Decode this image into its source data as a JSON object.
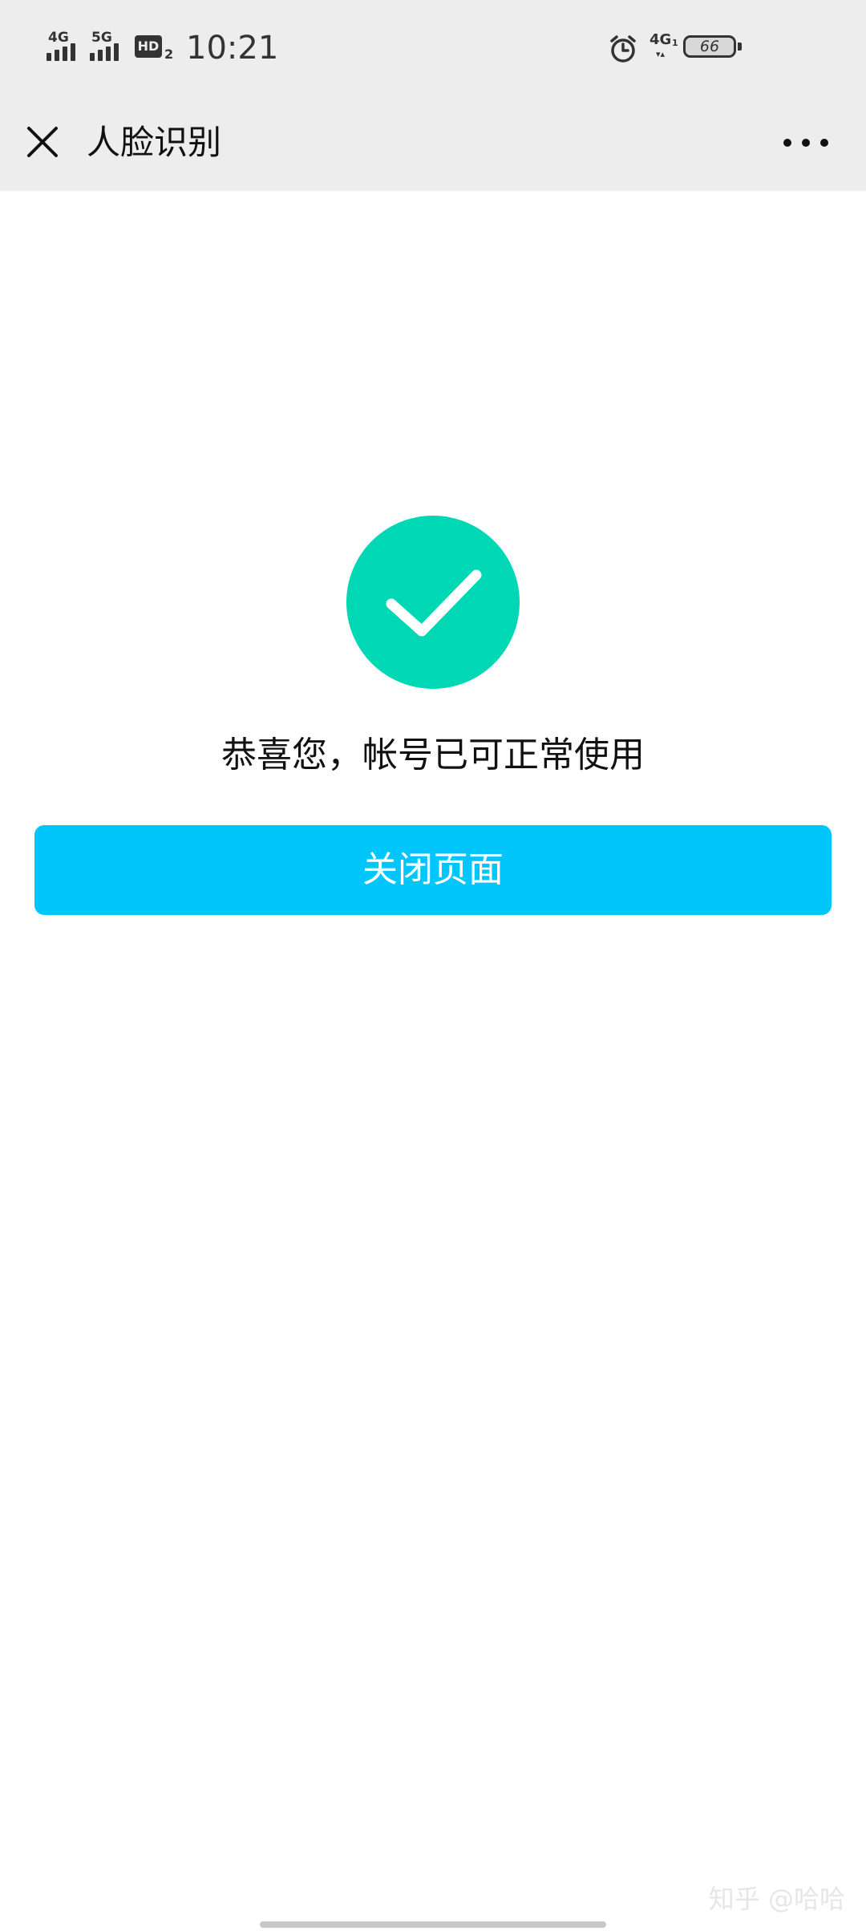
{
  "status_bar": {
    "sim1_network": "4G",
    "sim2_network": "5G",
    "hd_label": "HD",
    "hd_sub": "2",
    "time": "10:21",
    "data_network": "4G",
    "data_network_sub": "1",
    "battery_level": "66",
    "icons": [
      "signal-icon",
      "hd-voice-icon",
      "alarm-clock-icon",
      "data-activity-icon",
      "battery-icon"
    ]
  },
  "nav": {
    "title": "人脸识别",
    "close_icon": "close-icon",
    "more_icon": "more-options-icon"
  },
  "main": {
    "status_icon": "check-circle-icon",
    "message": "恭喜您，帐号已可正常使用",
    "button_label": "关闭页面"
  },
  "watermark": "知乎 @哈哈",
  "colors": {
    "chrome_background": "#ededed",
    "page_background": "#ffffff",
    "success_green": "#00d7b4",
    "button_blue": "#00c6fb",
    "button_text": "#ffffff"
  }
}
